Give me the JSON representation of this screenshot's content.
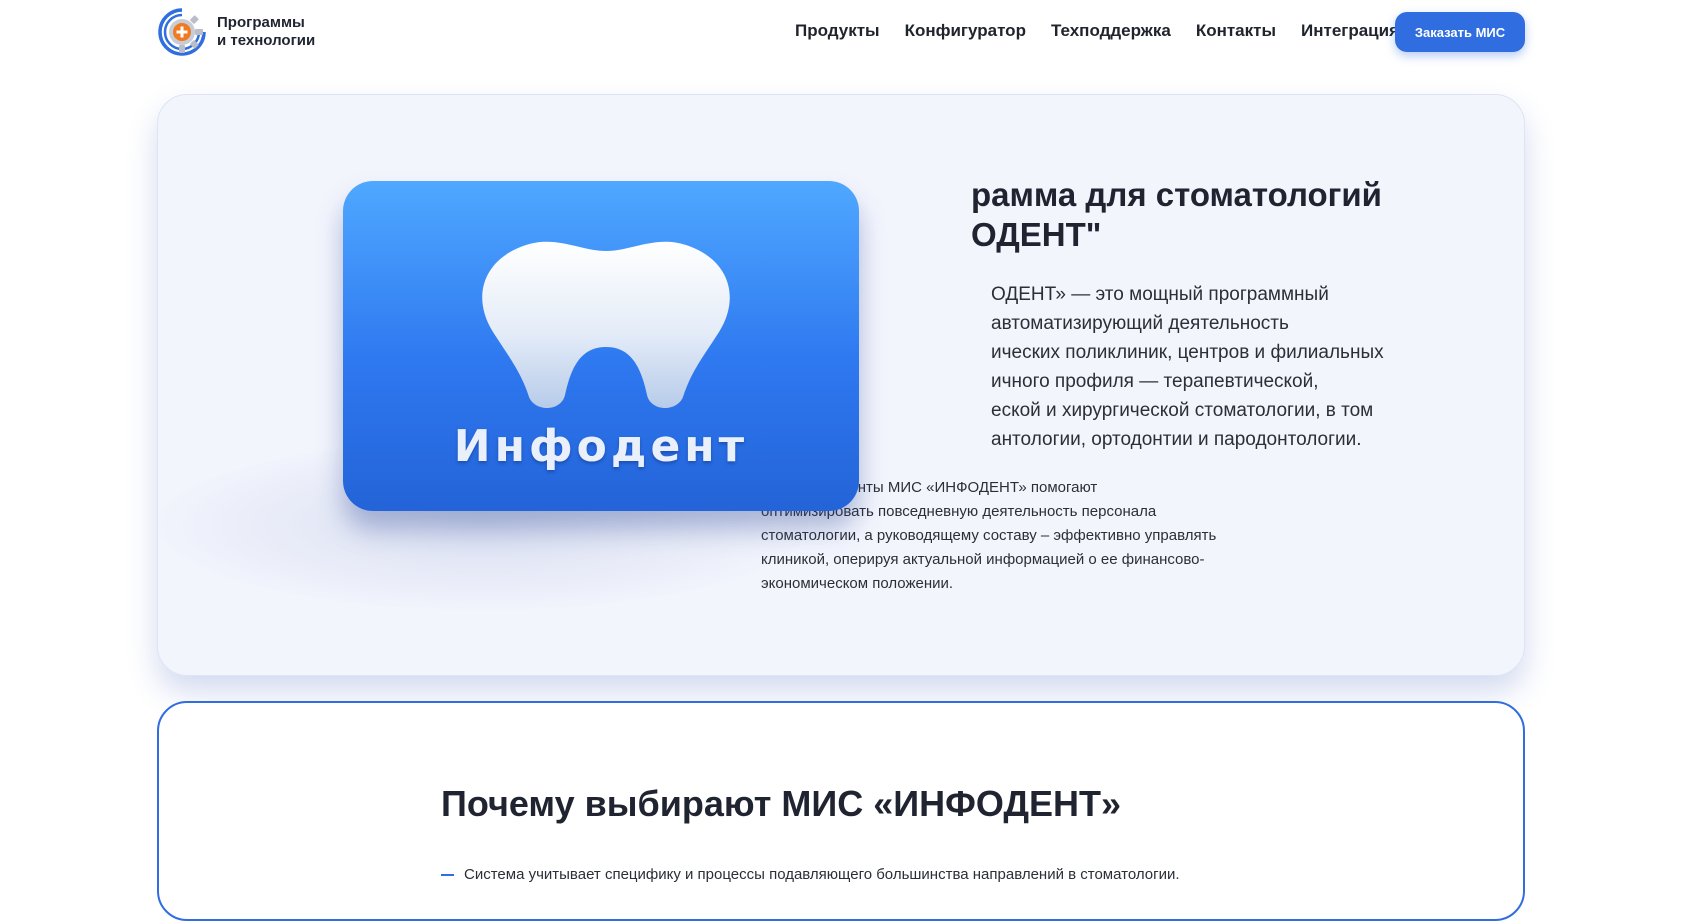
{
  "brand": {
    "line1": "Программы",
    "line2": "и технологии",
    "accent_orange": "#f07a20",
    "accent_blue": "#2f6de0"
  },
  "nav": {
    "items": [
      {
        "label": "Продукты"
      },
      {
        "label": "Конфигуратор"
      },
      {
        "label": "Техподдержка"
      },
      {
        "label": "Контакты"
      },
      {
        "label": "Интеграция"
      }
    ],
    "cta_label": "Заказать МИС"
  },
  "hero": {
    "title_line1": "рамма для стоматологий",
    "title_line2": "ОДЕНТ\"",
    "description_lines": [
      "ОДЕНТ» — это мощный программный",
      "автоматизирующий деятельность",
      "ических поликлиник, центров и филиальных",
      "ичного профиля — терапевтической,",
      "еской и хирургической стоматологии, в том",
      "антологии, ортодонтии и пародонтологии."
    ],
    "details_lines": [
      "ные инструменты МИС «ИНФОДЕНТ» помогают",
      "оптимизировать повседневную деятельность персонала",
      "стоматологии, а руководящему составу – эффективно управлять",
      "клиникой, оперируя актуальной информацией о ее финансово-",
      "экономическом положении."
    ],
    "product_name": "Инфодент"
  },
  "why": {
    "title": "Почему выбирают МИС «ИНФОДЕНТ»",
    "items": [
      {
        "text": "Система учитывает специфику и процессы подавляющего большинства направлений в стоматологии."
      }
    ]
  }
}
